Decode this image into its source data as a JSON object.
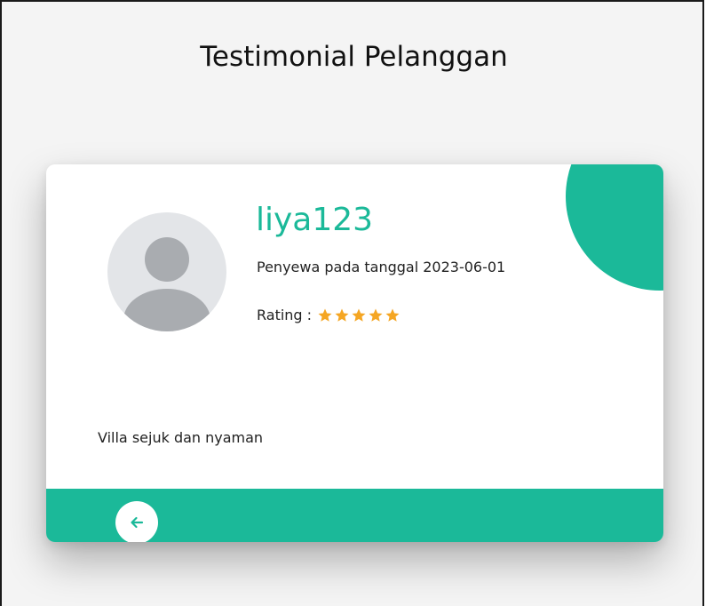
{
  "page": {
    "title": "Testimonial Pelanggan"
  },
  "testimonial": {
    "username": "liya123",
    "tenant_date_text": "Penyewa pada tanggal 2023-06-01",
    "rating_label": "Rating :",
    "rating_value": 5,
    "rating_max": 5,
    "review_text": "Villa sejuk dan nyaman"
  },
  "icons": {
    "avatar": "default-user-avatar-icon",
    "star": "star-icon",
    "back": "arrow-left-icon"
  },
  "colors": {
    "accent": "#1bb999",
    "star": "#f5a623",
    "background": "#f4f4f4",
    "avatar_bg": "#e3e5e8",
    "avatar_fg": "#a9acb0"
  }
}
